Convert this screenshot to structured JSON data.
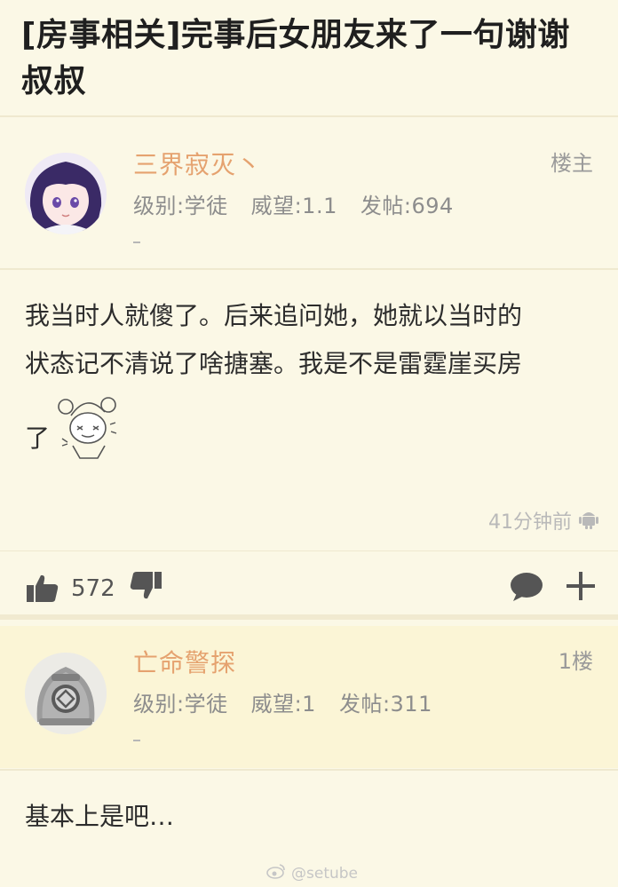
{
  "thread": {
    "title": "[房事相关]完事后女朋友来了一句谢谢叔叔"
  },
  "posts": [
    {
      "username": "三界寂灭丶",
      "floor": "楼主",
      "level": "级别:学徒",
      "reputation": "威望:1.1",
      "post_count": "发帖:694",
      "body_line1": "我当时人就傻了。后来追问她，她就以当时的",
      "body_line2": "状态记不清说了啥搪塞。我是不是雷霆崖买房",
      "body_line3": "了",
      "time": "41分钟前",
      "likes": "572"
    },
    {
      "username": "亡命警探",
      "floor": "1楼",
      "level": "级别:学徒",
      "reputation": "威望:1",
      "post_count": "发帖:311",
      "body": "基本上是吧…"
    }
  ],
  "watermark": "@setube",
  "colors": {
    "background": "#fbf8e6",
    "username": "#e5a26f",
    "meta": "#8d8d8d"
  },
  "icons": [
    "android-icon",
    "thumbs-up-icon",
    "thumbs-down-icon",
    "comment-icon",
    "plus-icon",
    "weibo-icon"
  ]
}
